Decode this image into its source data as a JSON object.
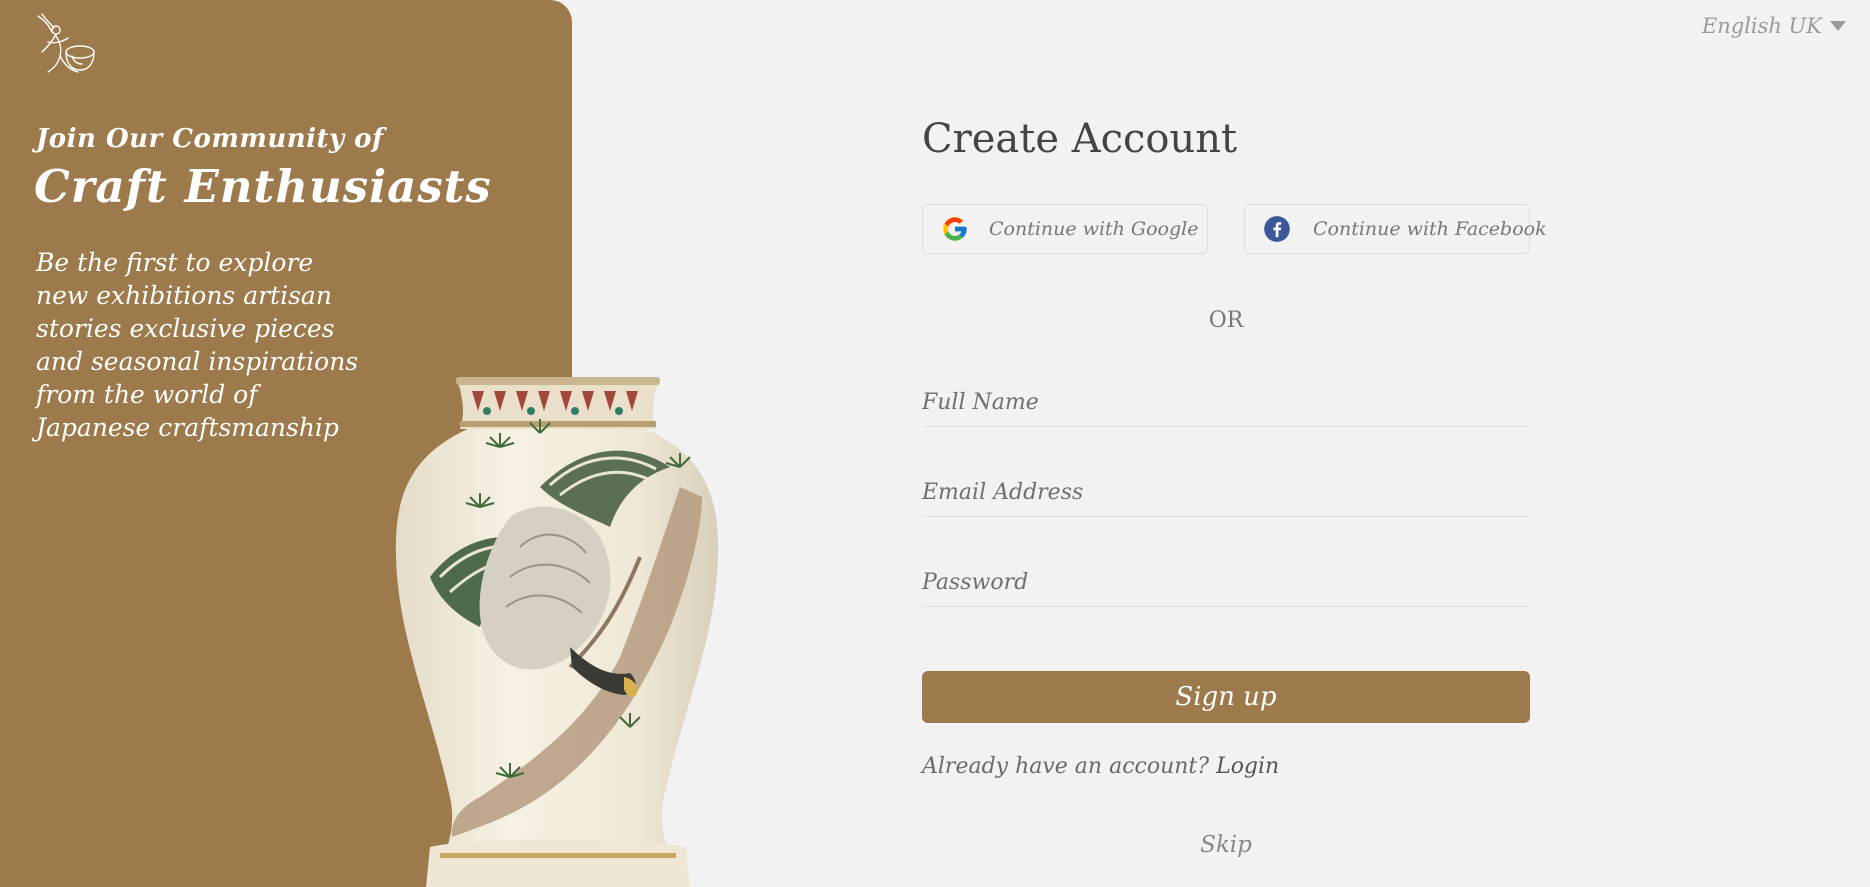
{
  "brand": {
    "primary": "#9c7a4c",
    "page_bg": "#f2f2f2",
    "logo_icon": "craft-figure-logo-icon"
  },
  "language": {
    "selected": "English  UK",
    "caret_icon": "caret-down-icon"
  },
  "hero": {
    "kicker": "Join Our Community of",
    "title": "Craft Enthusiasts",
    "body": "Be the first to explore new exhibitions artisan stories exclusive pieces and seasonal inspirations from the world of Japanese craftsmanship",
    "image_icon": "decorated-vase-image"
  },
  "form": {
    "title": "Create Account",
    "social": {
      "google_label": "Continue with Google",
      "google_icon": "google-icon",
      "facebook_label": "Continue with Facebook",
      "facebook_icon": "facebook-icon"
    },
    "or_label": "OR",
    "fields": {
      "full_name_placeholder": "Full Name",
      "email_placeholder": "Email Address",
      "password_placeholder": "Password"
    },
    "submit_label": "Sign up",
    "login_prompt": "Already have an account?",
    "login_link": "Login",
    "skip_label": "Skip"
  }
}
